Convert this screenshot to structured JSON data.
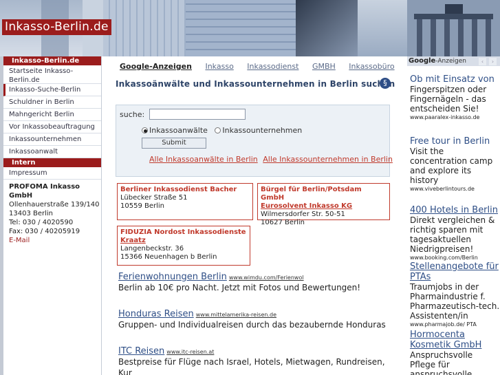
{
  "header": {
    "logo": "Inkasso-Berlin.de"
  },
  "leftnav": {
    "head1": "Inkasso-Berlin.de",
    "items": [
      "Startseite Inkasso-Berlin.de",
      "Inkasso-Suche-Berlin",
      "Schuldner in Berlin",
      "Mahngericht Berlin",
      "Vor Inkassobeauftragung",
      "Inkassounternehmen",
      "Inkassoanwalt"
    ],
    "head2": "Intern",
    "impressum": "Impressum",
    "address": {
      "name": "PROFOMA Inkasso GmbH",
      "street": "Ollenhauerstraße 139/140",
      "city": "13403 Berlin",
      "tel": "Tel: 030 / 4020590",
      "fax": "Fax: 030 / 40205919",
      "email": "E-Mail"
    }
  },
  "tabs": {
    "google": "Google-Anzeigen",
    "t1": "Inkasso",
    "t2": "Inkassodienst",
    "t3": "GMBH",
    "t4": "Inkassobüro"
  },
  "search": {
    "title": "Inkassoänwälte und Inkassounternehmen in Berlin suchen",
    "label": "suche:",
    "input_value": "",
    "radio1": "Inkassoanwälte",
    "radio2": "Inkassounternehmen",
    "submit": "Submit",
    "link1": "Alle Inkassoanwälte in Berlin",
    "link2": "Alle Inkassounternehmen in Berlin"
  },
  "cards": [
    {
      "title": "Berliner Inkassodienst Bacher",
      "sub": "",
      "street": "Lübecker Straße 51",
      "city": "10559 Berlin"
    },
    {
      "title": "Bürgel für Berlin/Potsdam GmbH",
      "sub": "Eurosolvent Inkasso KG",
      "street": "Wilmersdorfer Str. 50-51",
      "city": "10627 Berlin"
    },
    {
      "title": "FIDUZIA Nordost Inkassodienste",
      "sub": "Kraatz",
      "street": "Langenbeckstr. 36",
      "city": "15366 Neuenhagen b Berlin"
    }
  ],
  "ads": [
    {
      "title": "Ferienwohnungen Berlin",
      "url": "www.wimdu.com/Ferienwol",
      "desc": "Berlin ab 10€ pro Nacht. Jetzt mit Fotos und Bewertungen!"
    },
    {
      "title": "Honduras Reisen",
      "url": "www.mittelamerika-reisen.de",
      "desc": "Gruppen- und Individualreisen durch das bezaubernde Honduras"
    },
    {
      "title": "ITC Reisen",
      "url": "www.itc-reisen.at",
      "desc": "Bestpreise für Flüge nach Israel, Hotels, Mietwagen, Rundreisen, Kur"
    }
  ],
  "right": {
    "google_label": "Google",
    "google_suffix": "-Anzeigen",
    "ads": [
      {
        "title": "Ob mit Einsatz von",
        "desc": "Fingerspitzen oder Fingernägeln - das entscheiden Sie!",
        "url": "www.paaralex-inkasso.de"
      },
      {
        "title": "Free tour in Berlin",
        "desc": "Visit the concentration camp and explore its history",
        "url": "www.viveberlintours.de"
      },
      {
        "title": "400 Hotels in Berlin",
        "desc": "Direkt vergleichen & richtig sparen mit tagesaktuellen Niedrigpreisen!",
        "url": "www.booking.com/Berlin"
      },
      {
        "title": "Stellenangebote für PTAs",
        "desc": "Traumjobs in der Pharmaindustrie f. Pharmazeutisch-tech. Assistenten/in",
        "url": "www.pharmajob.de/ PTA"
      },
      {
        "title": "Hormocenta Kosmetik GmbH",
        "desc": "Anspruchsvolle Pflege für anspruchsvolle",
        "url": ""
      }
    ]
  }
}
